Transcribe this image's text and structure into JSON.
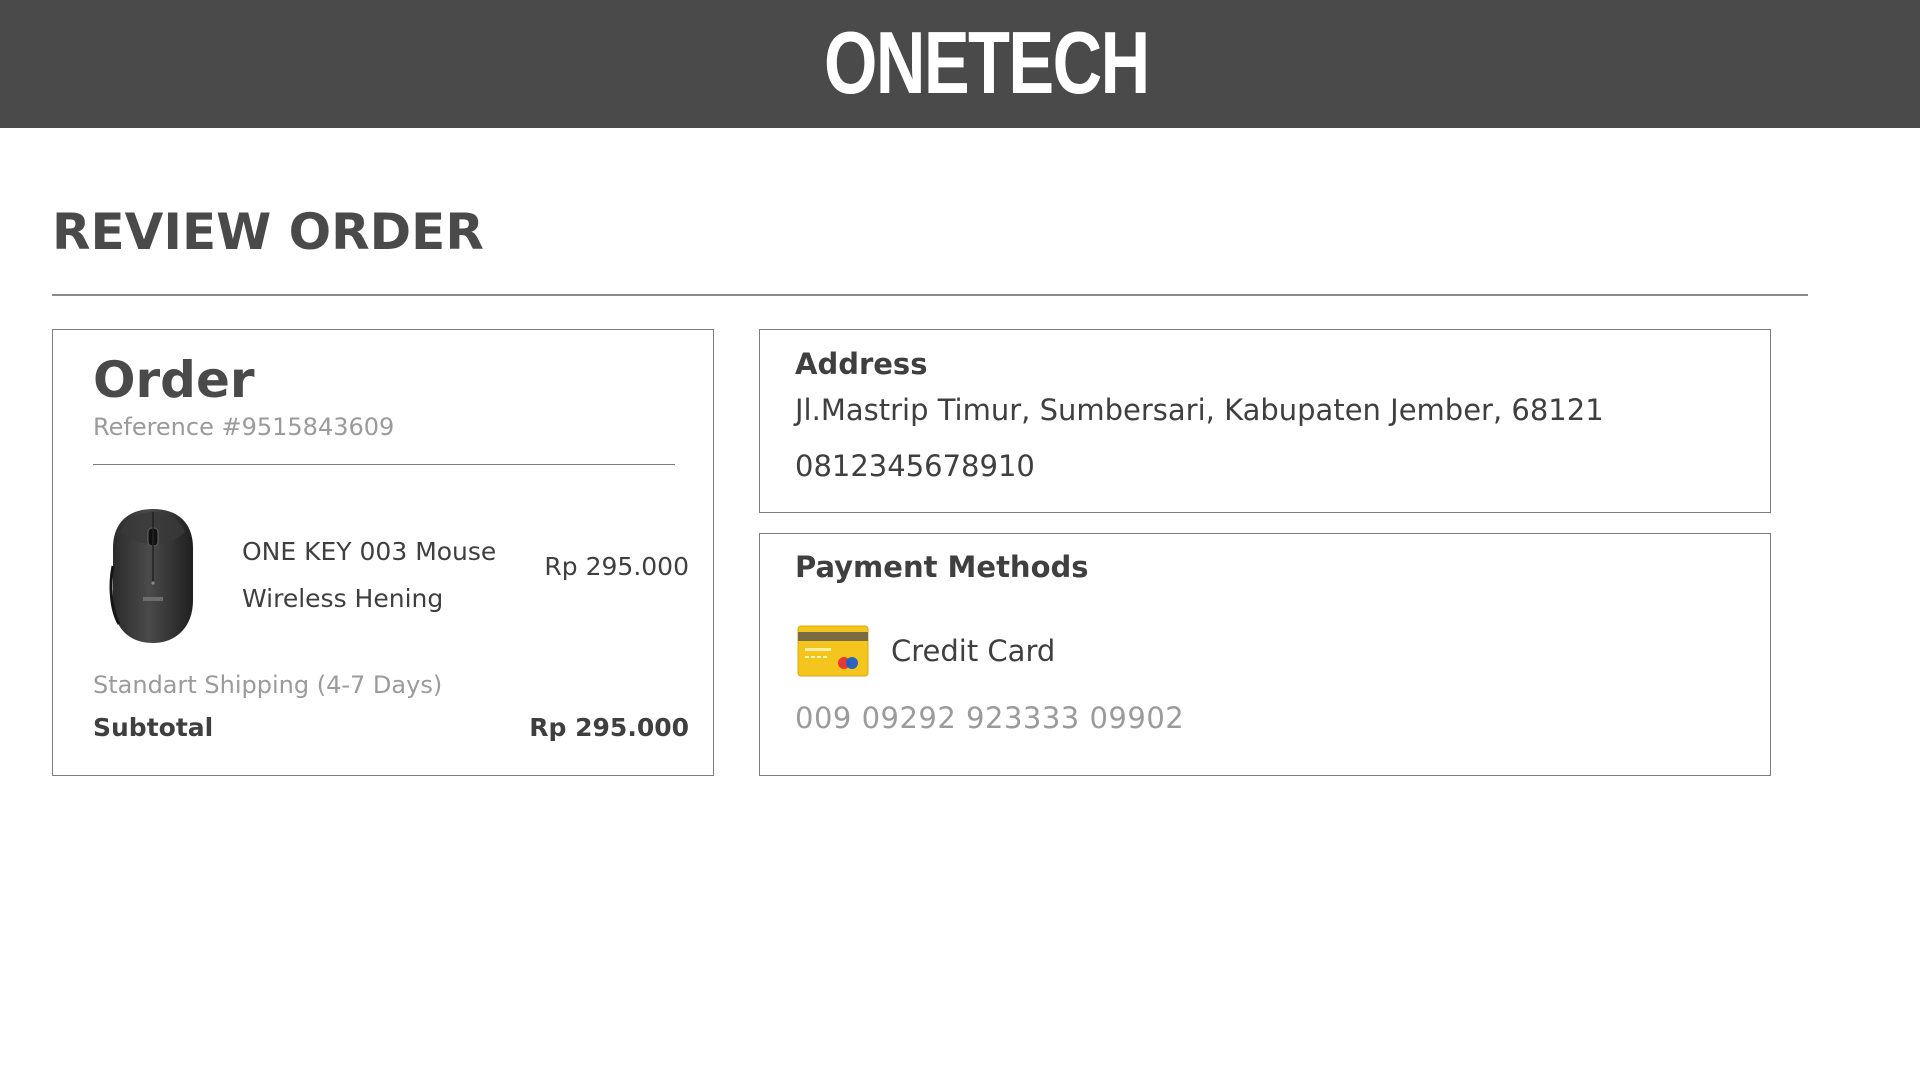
{
  "header": {
    "logo_text": "ONETECH",
    "background_color": "#4a4a4a"
  },
  "page": {
    "title": "REVIEW ORDER"
  },
  "order": {
    "heading": "Order",
    "reference": "Reference #9515843609",
    "product": {
      "name": "ONE KEY 003 Mouse Wireless Hening",
      "price": "Rp 295.000",
      "image": "wireless-mouse-image"
    },
    "shipping": "Standart Shipping (4-7 Days)",
    "subtotal_label": "Subtotal",
    "subtotal_value": "Rp 295.000"
  },
  "address": {
    "title": "Address",
    "line": "Jl.Mastrip Timur, Sumbersari, Kabupaten Jember, 68121",
    "phone": "0812345678910"
  },
  "payment": {
    "title": "Payment Methods",
    "method_icon": "credit-card-icon",
    "method_label": "Credit Card",
    "card_number": "009 09292 923333 09902",
    "card_icon_color": "#f5c518"
  }
}
